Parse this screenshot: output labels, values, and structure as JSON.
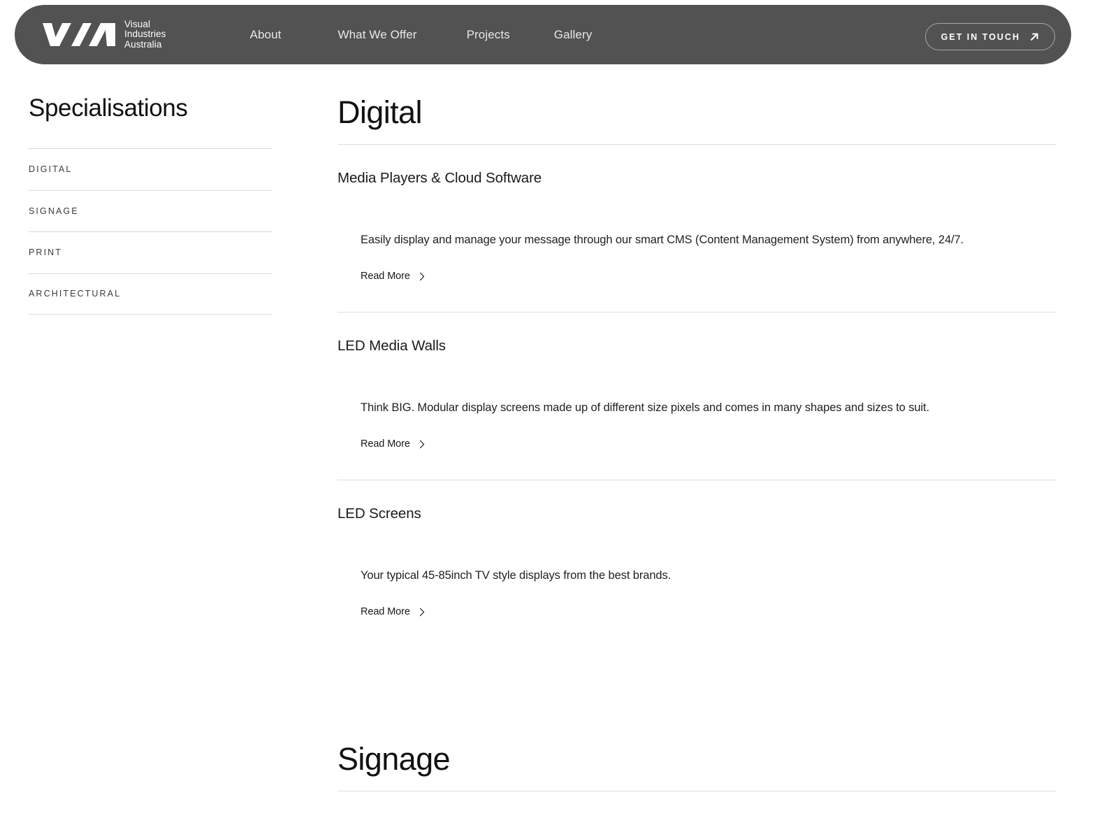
{
  "header": {
    "logo_icon": "via-logo-icon",
    "brand_lines": "Visual\nIndustries\nAustralia",
    "nav": [
      {
        "label": "About"
      },
      {
        "label": "What We Offer"
      },
      {
        "label": "Projects"
      },
      {
        "label": "Gallery"
      }
    ],
    "cta": {
      "label": "GET IN TOUCH",
      "icon": "arrow-up-right-icon"
    },
    "bar_color": "#525252",
    "text_color": "#ffffff"
  },
  "sidebar": {
    "title": "Specialisations",
    "items": [
      {
        "label": "DIGITAL"
      },
      {
        "label": "SIGNAGE"
      },
      {
        "label": "PRINT"
      },
      {
        "label": "ARCHITECTURAL"
      }
    ]
  },
  "main": {
    "sections": [
      {
        "title": "Digital",
        "items": [
          {
            "heading": "Media Players & Cloud Software",
            "description": "Easily display and manage your message through our smart CMS (Content Management System) from anywhere, 24/7.",
            "read_more": "Read More",
            "chevron_icon": "chevron-right-icon"
          },
          {
            "heading": "LED Media Walls",
            "description": "Think BIG. Modular display screens made up of different size pixels and comes in many shapes and sizes to suit.",
            "read_more": "Read More",
            "chevron_icon": "chevron-right-icon"
          },
          {
            "heading": "LED Screens",
            "description": "Your typical 45-85inch TV style displays from the best brands.",
            "read_more": "Read More",
            "chevron_icon": "chevron-right-icon"
          }
        ]
      },
      {
        "title": "Signage",
        "items": []
      }
    ]
  },
  "colors": {
    "page_background": "#ffffff",
    "header_bar": "#525252",
    "rule": "#dedede",
    "heading_text": "#111111",
    "body_text": "#222222",
    "sidebar_item_text": "#3a3a3a"
  }
}
